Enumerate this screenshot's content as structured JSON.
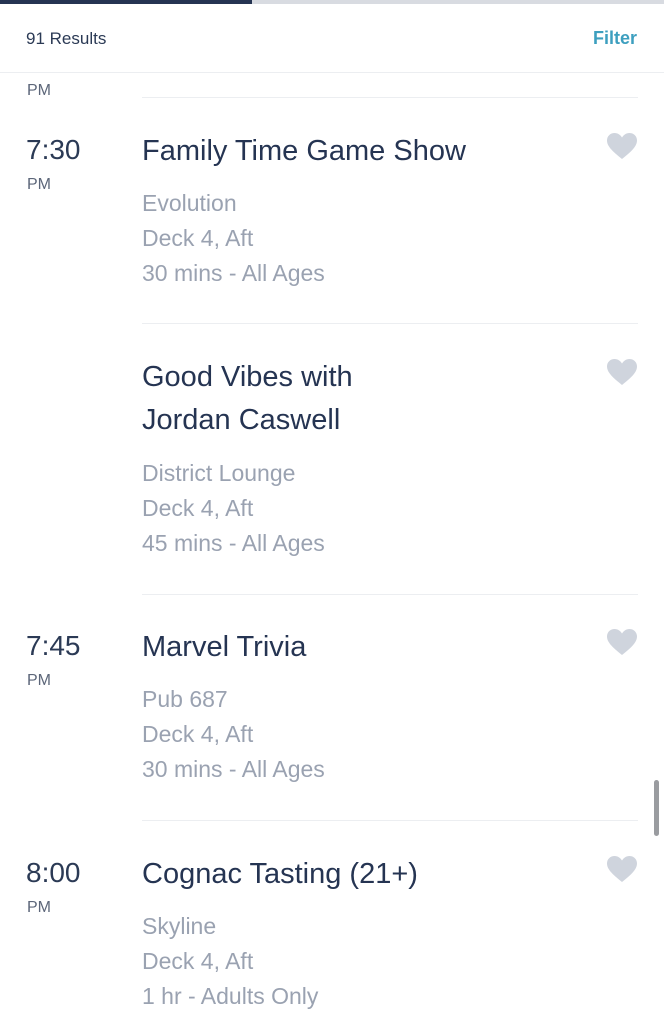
{
  "progress": {
    "fraction": 0.38
  },
  "header": {
    "results": "91 Results",
    "filter": "Filter"
  },
  "top_fragment": {
    "ampm": "PM"
  },
  "items": [
    {
      "time": "7:30",
      "ampm": "PM",
      "title": "Family Time Game Show",
      "venue": "Evolution",
      "location": "Deck 4, Aft",
      "duration": "30 mins - All Ages"
    },
    {
      "time": "",
      "ampm": "",
      "title": "Good Vibes with Jordan Caswell",
      "venue": "District Lounge",
      "location": "Deck 4, Aft",
      "duration": "45 mins - All Ages"
    },
    {
      "time": "7:45",
      "ampm": "PM",
      "title": "Marvel Trivia",
      "venue": "Pub 687",
      "location": "Deck 4, Aft",
      "duration": "30 mins - All Ages"
    },
    {
      "time": "8:00",
      "ampm": "PM",
      "title": "Cognac Tasting (21+)",
      "venue": "Skyline",
      "location": "Deck 4, Aft",
      "duration": "1 hr - Adults Only"
    }
  ],
  "icons": {
    "favorite": "heart-icon"
  },
  "colors": {
    "accent": "#3d9fbf",
    "heart": "#cfd4dd",
    "title": "#253452"
  }
}
